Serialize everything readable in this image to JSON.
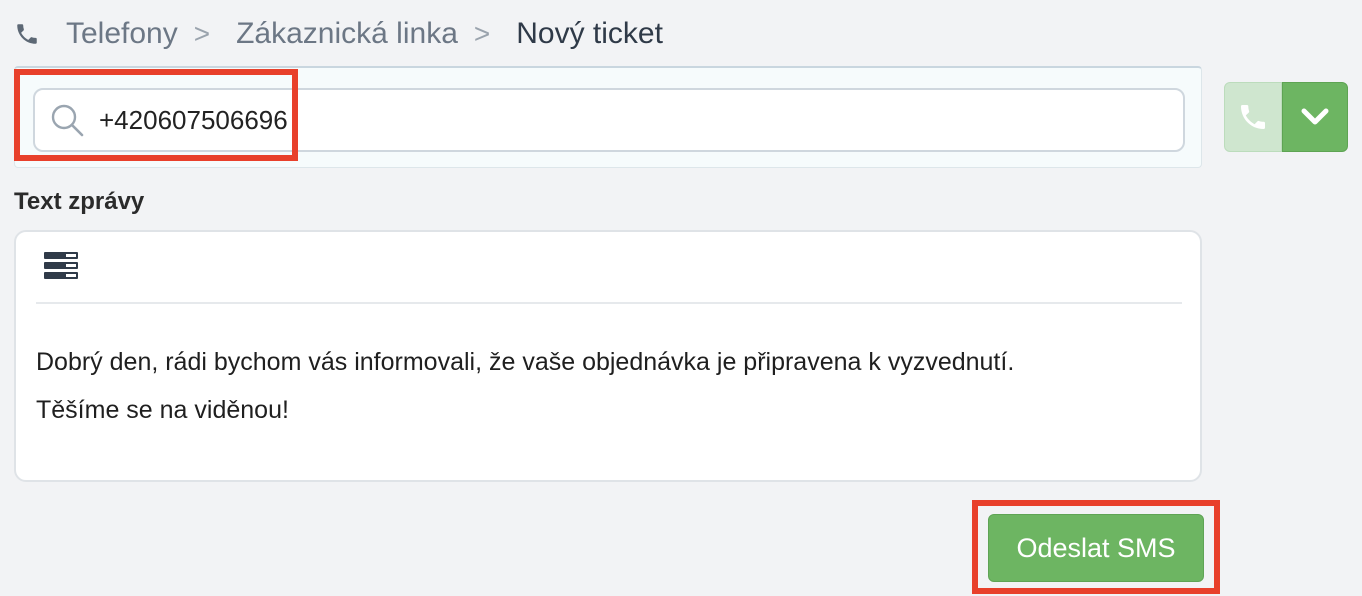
{
  "breadcrumb": {
    "items": [
      "Telefony",
      "Zákaznická linka"
    ],
    "separator": ">",
    "current": "Nový ticket"
  },
  "search": {
    "value": "+420607506696"
  },
  "message": {
    "label": "Text zprávy",
    "text": "Dobrý den, rádi bychom vás informovali, že vaše objednávka je připravena k vyzvednutí.\nTěšíme se na viděnou!"
  },
  "actions": {
    "send_label": "Odeslat SMS"
  },
  "colors": {
    "accent_green": "#6db562",
    "highlight_red": "#e8402b"
  },
  "icons": {
    "breadcrumb": "phone-icon",
    "search": "search-icon",
    "call": "phone-icon",
    "dropdown": "chevron-down-icon",
    "toolbar": "snippet-list-icon"
  }
}
